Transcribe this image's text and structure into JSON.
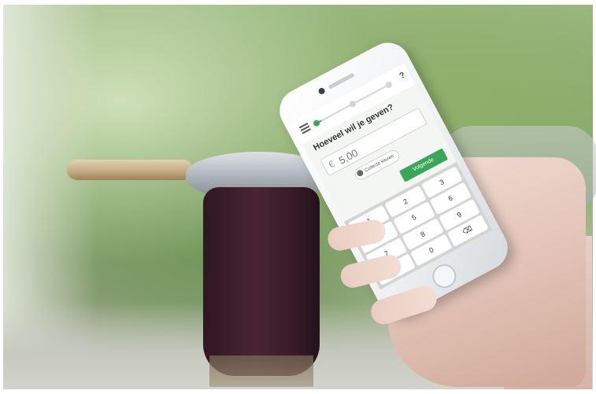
{
  "app": {
    "question": "Hoeveel wil je geven?",
    "currency_symbol": "€",
    "amount_placeholder": "5,00",
    "chip_label": "Collecte kiezen",
    "next_label": "Volgende",
    "help_label": "?",
    "progress": {
      "steps": 3,
      "current": 1
    }
  },
  "keypad": {
    "keys": [
      "1",
      "2",
      "3",
      "4",
      "5",
      "6",
      "7",
      "8",
      "9",
      ",",
      "0",
      "⌫"
    ]
  },
  "icons": {
    "menu": "hamburger-menu-icon",
    "help": "question-mark-icon",
    "chip": "collection-icon",
    "backspace": "backspace-icon"
  },
  "colors": {
    "accent": "#3aa657",
    "pot": "#3a1c28"
  }
}
